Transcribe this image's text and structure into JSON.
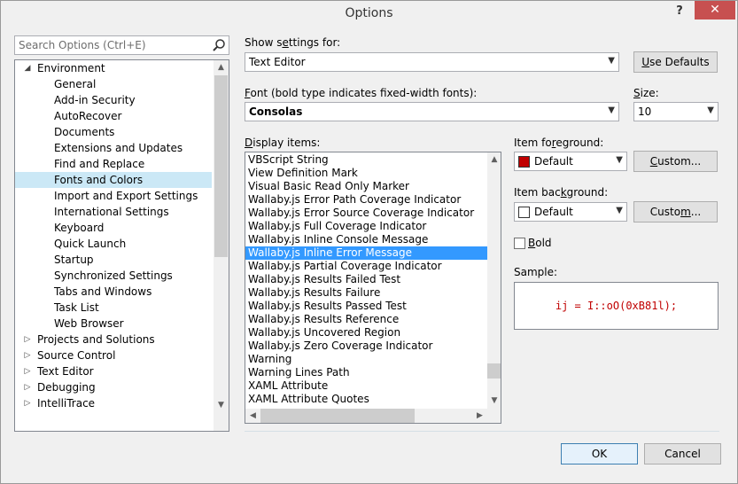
{
  "window": {
    "title": "Options",
    "help": "?",
    "close": "✕"
  },
  "search": {
    "placeholder": "Search Options (Ctrl+E)"
  },
  "tree": [
    {
      "label": "Environment",
      "arrow": "◢",
      "depth": 0
    },
    {
      "label": "General",
      "depth": 1
    },
    {
      "label": "Add-in Security",
      "depth": 1
    },
    {
      "label": "AutoRecover",
      "depth": 1
    },
    {
      "label": "Documents",
      "depth": 1
    },
    {
      "label": "Extensions and Updates",
      "depth": 1
    },
    {
      "label": "Find and Replace",
      "depth": 1
    },
    {
      "label": "Fonts and Colors",
      "depth": 1,
      "selected": true
    },
    {
      "label": "Import and Export Settings",
      "depth": 1
    },
    {
      "label": "International Settings",
      "depth": 1
    },
    {
      "label": "Keyboard",
      "depth": 1
    },
    {
      "label": "Quick Launch",
      "depth": 1
    },
    {
      "label": "Startup",
      "depth": 1
    },
    {
      "label": "Synchronized Settings",
      "depth": 1
    },
    {
      "label": "Tabs and Windows",
      "depth": 1
    },
    {
      "label": "Task List",
      "depth": 1
    },
    {
      "label": "Web Browser",
      "depth": 1
    },
    {
      "label": "Projects and Solutions",
      "arrow": "▷",
      "depth": 0
    },
    {
      "label": "Source Control",
      "arrow": "▷",
      "depth": 0
    },
    {
      "label": "Text Editor",
      "arrow": "▷",
      "depth": 0
    },
    {
      "label": "Debugging",
      "arrow": "▷",
      "depth": 0
    },
    {
      "label": "IntelliTrace",
      "arrow": "▷",
      "depth": 0
    }
  ],
  "settings": {
    "show_for_label": {
      "pre": "Show s",
      "u": "e",
      "post": "ttings for:"
    },
    "show_for_value": "Text Editor",
    "use_defaults": {
      "pre": "",
      "u": "U",
      "post": "se Defaults"
    },
    "font_label": {
      "pre": "",
      "u": "F",
      "post": "ont (bold type indicates fixed-width fonts):"
    },
    "font_value": "Consolas",
    "size_label": {
      "pre": "",
      "u": "S",
      "post": "ize:"
    },
    "size_value": "10",
    "display_label": {
      "pre": "",
      "u": "D",
      "post": "isplay items:"
    },
    "display_items": [
      "VBScript String",
      "View Definition Mark",
      "Visual Basic Read Only Marker",
      "Wallaby.js Error Path Coverage Indicator",
      "Wallaby.js Error Source Coverage Indicator",
      "Wallaby.js Full Coverage Indicator",
      "Wallaby.js Inline Console Message",
      "Wallaby.js Inline Error Message",
      "Wallaby.js Partial Coverage Indicator",
      "Wallaby.js Results Failed Test",
      "Wallaby.js Results Failure",
      "Wallaby.js Results Passed Test",
      "Wallaby.js Results Reference",
      "Wallaby.js Uncovered Region",
      "Wallaby.js Zero Coverage Indicator",
      "Warning",
      "Warning Lines Path",
      "XAML Attribute",
      "XAML Attribute Quotes"
    ],
    "selected_index": 7,
    "fg_label": {
      "pre": "Item fo",
      "u": "r",
      "post": "eground:"
    },
    "fg_value": "Default",
    "fg_color": "#c00000",
    "fg_custom": {
      "pre": "",
      "u": "C",
      "post": "ustom..."
    },
    "bg_label": {
      "pre": "Item bac",
      "u": "k",
      "post": "ground:"
    },
    "bg_value": "Default",
    "bg_color": "#ffffff",
    "bg_custom": {
      "pre": "Custo",
      "u": "m",
      "post": "..."
    },
    "bold_label": {
      "pre": "",
      "u": "B",
      "post": "old"
    },
    "sample_label": "Sample:",
    "sample_text": "ij = I::oO(0xB81l);",
    "sample_color": "#c00000"
  },
  "buttons": {
    "ok": "OK",
    "cancel": "Cancel"
  }
}
